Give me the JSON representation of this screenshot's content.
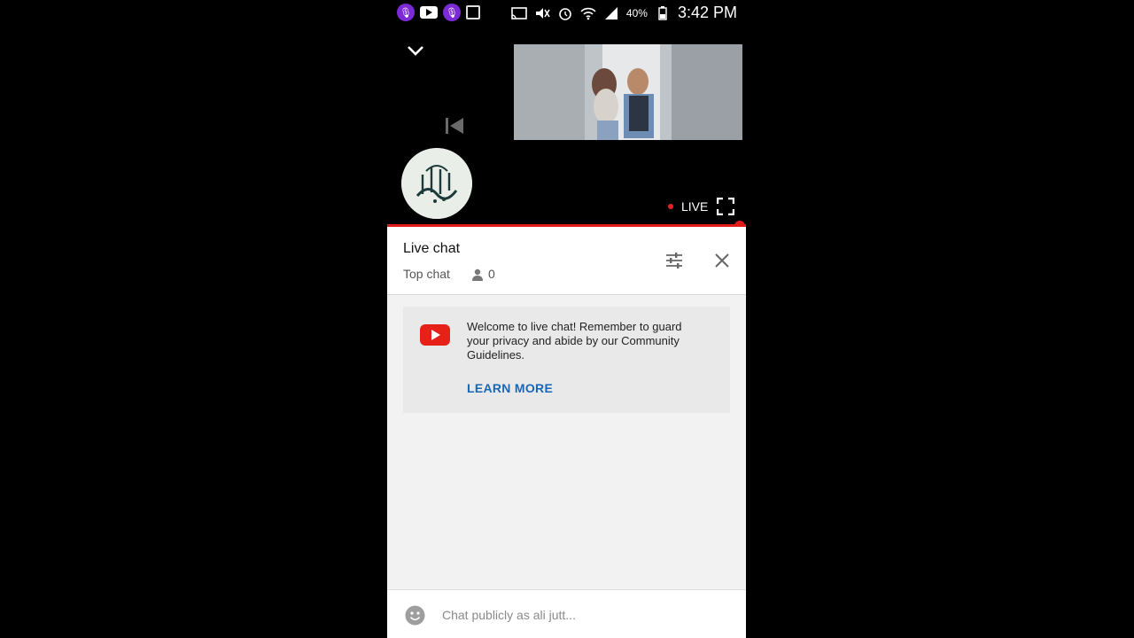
{
  "status_bar": {
    "battery_percent": "40%",
    "clock": "3:42 PM",
    "left_icons": [
      "podcast-app-icon",
      "youtube-notification-icon",
      "podcast-app-icon",
      "gallery-icon"
    ],
    "right_icons": [
      "cast-icon",
      "mute-icon",
      "alarm-icon",
      "wifi-icon",
      "signal-icon",
      "battery-icon"
    ]
  },
  "player": {
    "collapse_icon": "chevron-down-icon",
    "previous_icon": "skip-previous-icon",
    "live_label": "LIVE",
    "live_color": "#e52222",
    "fullscreen_icon": "fullscreen-icon",
    "progress_color": "#e21a1a"
  },
  "chat": {
    "title": "Live chat",
    "mode": "Top chat",
    "viewer_count": "0",
    "filter_icon": "tune-icon",
    "close_icon": "close-icon",
    "welcome": {
      "message": "Welcome to live chat! Remember to guard your privacy and abide by our Community Guidelines.",
      "learn_more": "LEARN MORE",
      "link_color": "#1a67b8"
    },
    "input": {
      "placeholder": "Chat publicly as ali jutt...",
      "value": ""
    }
  }
}
